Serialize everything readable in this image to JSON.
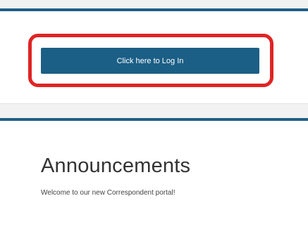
{
  "login": {
    "button_label": "Click here to Log In"
  },
  "announcements": {
    "title": "Announcements",
    "message": "Welcome to our new Correspondent portal!"
  },
  "colors": {
    "accent": "#1b5f86",
    "highlight": "#e02424",
    "background": "#f2f2f2",
    "card": "#ffffff"
  }
}
